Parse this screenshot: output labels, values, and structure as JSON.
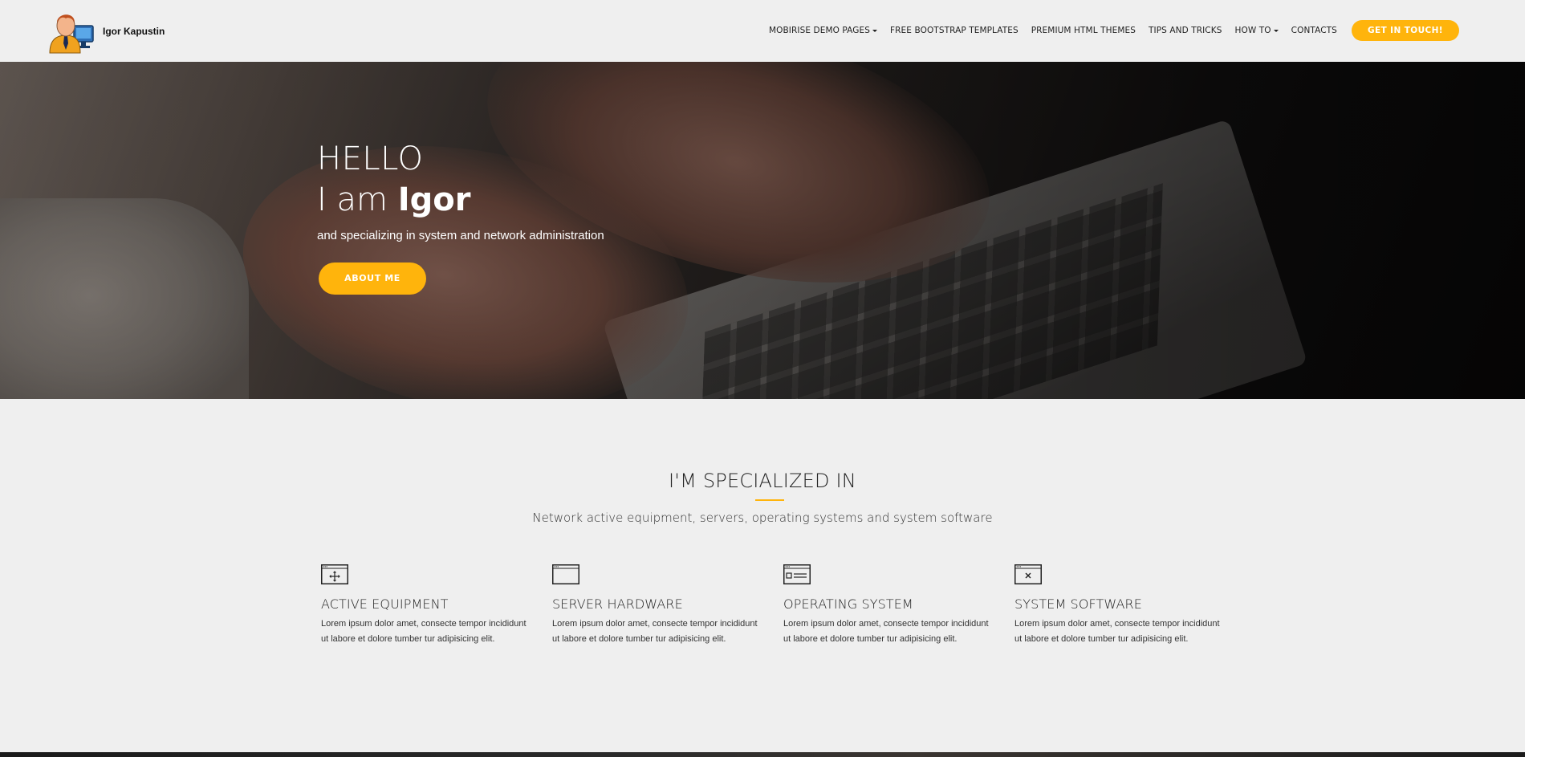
{
  "brand": {
    "name": "Igor Kapustin",
    "logo_icon": "user-computer-icon"
  },
  "nav": {
    "items": [
      {
        "label": "MOBIRISE DEMO PAGES",
        "dropdown": true
      },
      {
        "label": "FREE BOOTSTRAP TEMPLATES",
        "dropdown": false
      },
      {
        "label": "PREMIUM HTML THEMES",
        "dropdown": false
      },
      {
        "label": "TIPS AND TRICKS",
        "dropdown": false
      },
      {
        "label": "HOW TO",
        "dropdown": true
      },
      {
        "label": "CONTACTS",
        "dropdown": false
      }
    ],
    "cta_label": "GET IN TOUCH!"
  },
  "hero": {
    "hello": "HELLO",
    "iam_prefix": "I am",
    "iam_name": "Igor",
    "subtitle": "and specializing in system and network administration",
    "button_label": "ABOUT ME"
  },
  "specialized": {
    "title": "I'M SPECIALIZED IN",
    "subtitle": "Network active equipment, servers, operating systems and system software",
    "features": [
      {
        "icon": "window-move-icon",
        "title": "ACTIVE EQUIPMENT",
        "text": "Lorem ipsum dolor amet, consecte tempor incididunt ut labore et dolore tumber tur adipisicing elit."
      },
      {
        "icon": "window-blank-icon",
        "title": "SERVER HARDWARE",
        "text": "Lorem ipsum dolor amet, consecte tempor incididunt ut labore et dolore tumber tur adipisicing elit."
      },
      {
        "icon": "window-list-icon",
        "title": "OPERATING SYSTEM",
        "text": "Lorem ipsum dolor amet, consecte tempor incididunt ut labore et dolore tumber tur adipisicing elit."
      },
      {
        "icon": "window-close-icon",
        "title": "SYSTEM SOFTWARE",
        "text": "Lorem ipsum dolor amet, consecte tempor incididunt ut labore et dolore tumber tur adipisicing elit."
      }
    ]
  },
  "colors": {
    "accent": "#ffb40c",
    "page_bg": "#efefef",
    "text_dark": "#232323"
  }
}
